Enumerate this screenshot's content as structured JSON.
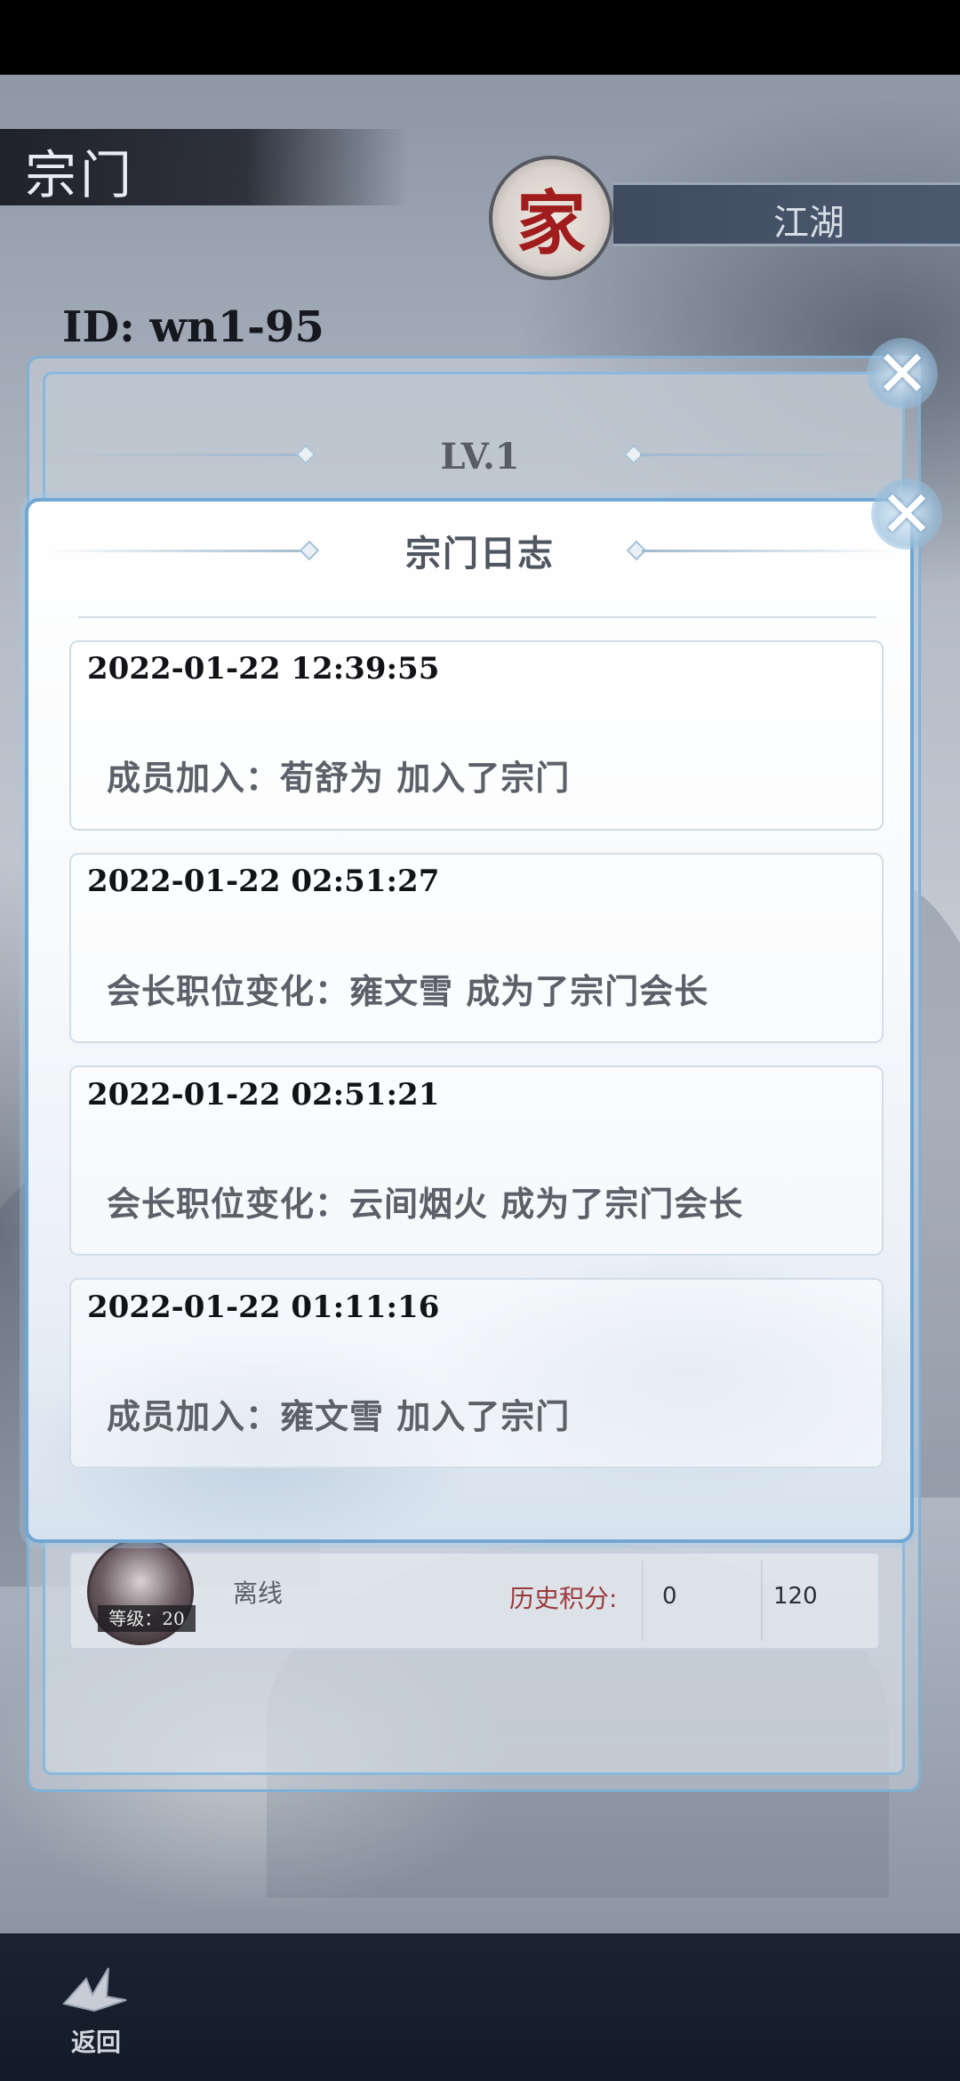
{
  "header": {
    "page_title": "宗门",
    "seal_glyph": "家",
    "world_tab": "江湖",
    "sect_id": "ID: wn1-95"
  },
  "back_panel": {
    "level": "LV.1",
    "member": {
      "status": "离线",
      "level_badge": "等级：20",
      "history_score_label": "历史积分:",
      "value_1": "0",
      "value_2": "120"
    }
  },
  "modal": {
    "title": "宗门日志",
    "close_icon": "close-icon",
    "logs": [
      {
        "time": "2022-01-22 12:39:55",
        "text": "成员加入：荀舒为 加入了宗门"
      },
      {
        "time": "2022-01-22 02:51:27",
        "text": "会长职位变化：雍文雪 成为了宗门会长"
      },
      {
        "time": "2022-01-22 02:51:21",
        "text": "会长职位变化：云间烟火 成为了宗门会长"
      },
      {
        "time": "2022-01-22 01:11:16",
        "text": "成员加入：雍文雪 加入了宗门"
      }
    ]
  },
  "bottom_nav": {
    "back_label": "返回",
    "back_icon": "crane-icon"
  },
  "colors": {
    "accent_border": "#6fa6d4",
    "seal_red": "#a11d1d",
    "history_label": "#9a3a3a"
  }
}
